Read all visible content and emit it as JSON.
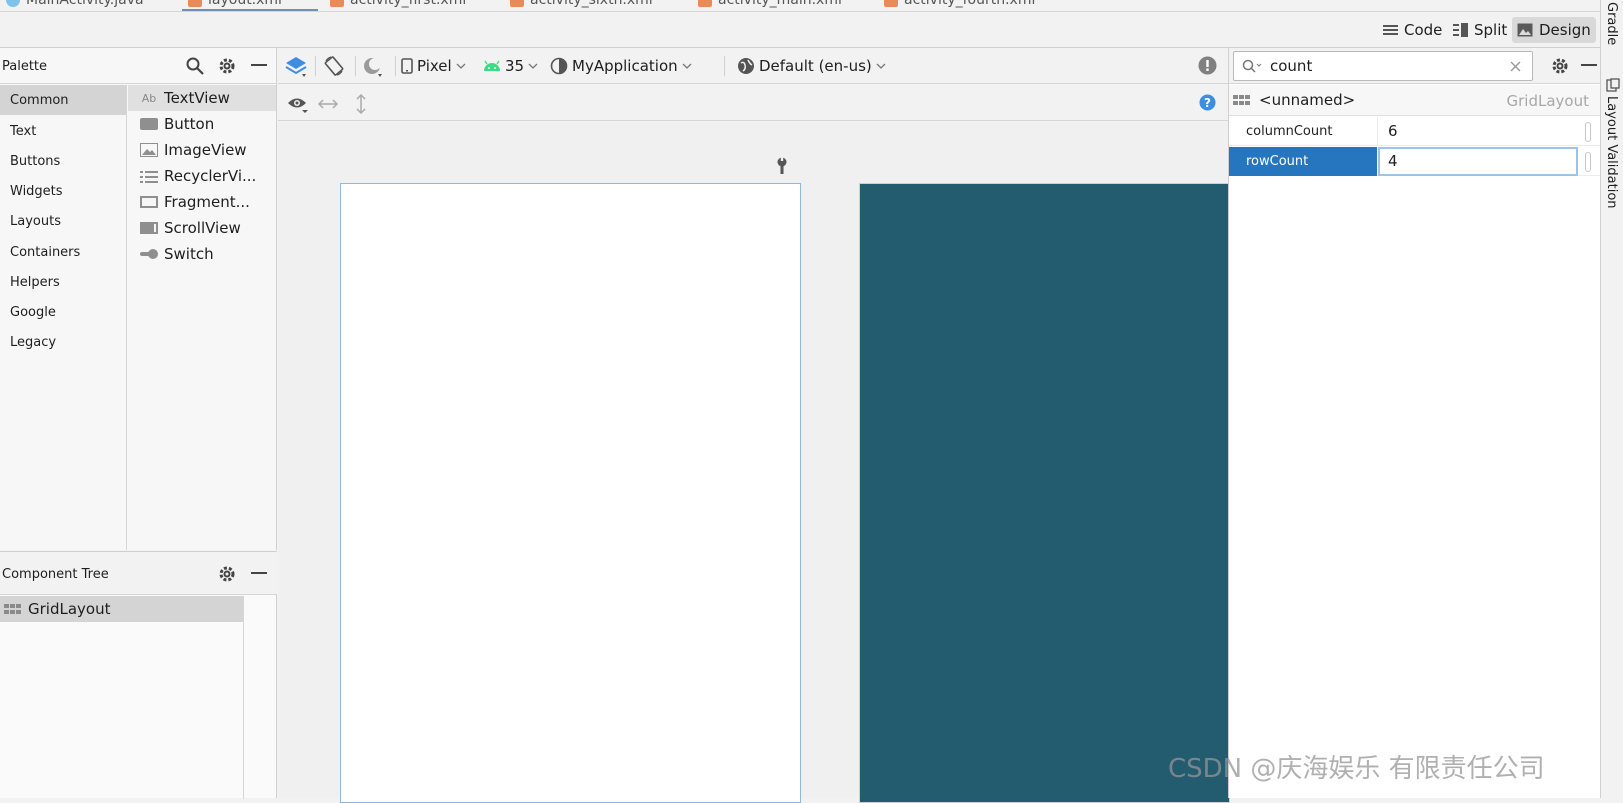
{
  "file_tabs": [
    "MainActivity.java",
    "layout.xml",
    "activity_first.xml",
    "activity_sixth.xml",
    "activity_main.xml",
    "activity_fourth.xml"
  ],
  "view_modes": {
    "code": "Code",
    "split": "Split",
    "design": "Design",
    "active": "Design"
  },
  "palette": {
    "title": "Palette",
    "categories": [
      "Common",
      "Text",
      "Buttons",
      "Widgets",
      "Layouts",
      "Containers",
      "Helpers",
      "Google",
      "Legacy"
    ],
    "selected_category": "Common",
    "widgets": [
      {
        "label": "TextView",
        "icon": "textview-icon"
      },
      {
        "label": "Button",
        "icon": "button-icon"
      },
      {
        "label": "ImageView",
        "icon": "imageview-icon"
      },
      {
        "label": "RecyclerVi...",
        "icon": "recyclerview-icon"
      },
      {
        "label": "Fragment...",
        "icon": "fragment-icon"
      },
      {
        "label": "ScrollView",
        "icon": "scrollview-icon"
      },
      {
        "label": "Switch",
        "icon": "switch-icon"
      }
    ]
  },
  "component_tree": {
    "title": "Component Tree",
    "root": "GridLayout"
  },
  "design_toolbar": {
    "device": "Pixel",
    "api_level": "35",
    "theme": "MyApplication",
    "locale": "Default (en-us)"
  },
  "attributes": {
    "search_value": "count",
    "component_name": "<unnamed>",
    "component_class": "GridLayout",
    "rows": [
      {
        "name": "columnCount",
        "value": "6",
        "selected": false
      },
      {
        "name": "rowCount",
        "value": "4",
        "selected": true
      }
    ]
  },
  "right_sidebar": {
    "gradle": "Gradle",
    "layout_validation": "Layout Validation"
  },
  "watermark": "CSDN @庆海娱乐 有限责任公司",
  "colors": {
    "selection_blue": "#2675bf",
    "design_surface": "#245c6f",
    "accent_blue": "#3d8ee0",
    "android_green": "#3ddc84",
    "warning_gray": "#808080"
  }
}
